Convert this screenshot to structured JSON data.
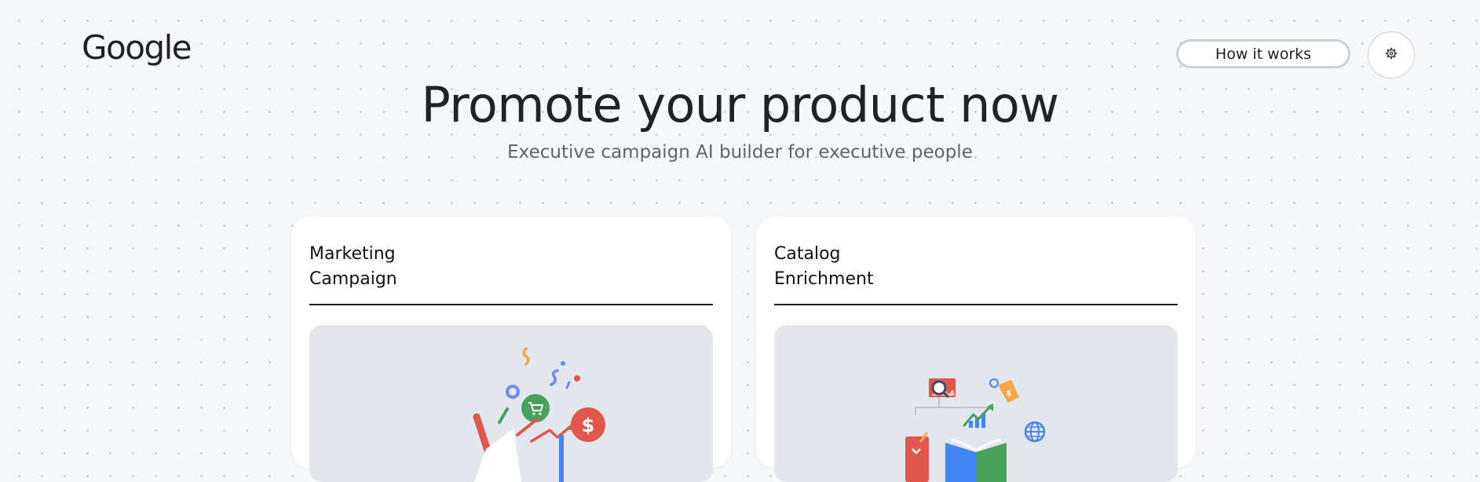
{
  "header": {
    "logo_text": "Google",
    "how_it_works_label": "How it works",
    "settings_icon": "gear-icon"
  },
  "hero": {
    "title": "Promote your product now",
    "subtitle": "Executive campaign AI builder for executive people"
  },
  "cards": [
    {
      "title_line1": "Marketing",
      "title_line2": "Campaign",
      "illustration": "megaphone-shopping-illustration"
    },
    {
      "title_line1": "Catalog",
      "title_line2": "Enrichment",
      "illustration": "open-book-catalog-illustration"
    }
  ],
  "colors": {
    "background": "#f6f7f9",
    "card": "#ffffff",
    "illustration_bg": "#e3e6ec",
    "google_blue": "#4285f4",
    "google_red": "#ea4335",
    "google_yellow": "#fbbc04",
    "google_green": "#34a853"
  }
}
